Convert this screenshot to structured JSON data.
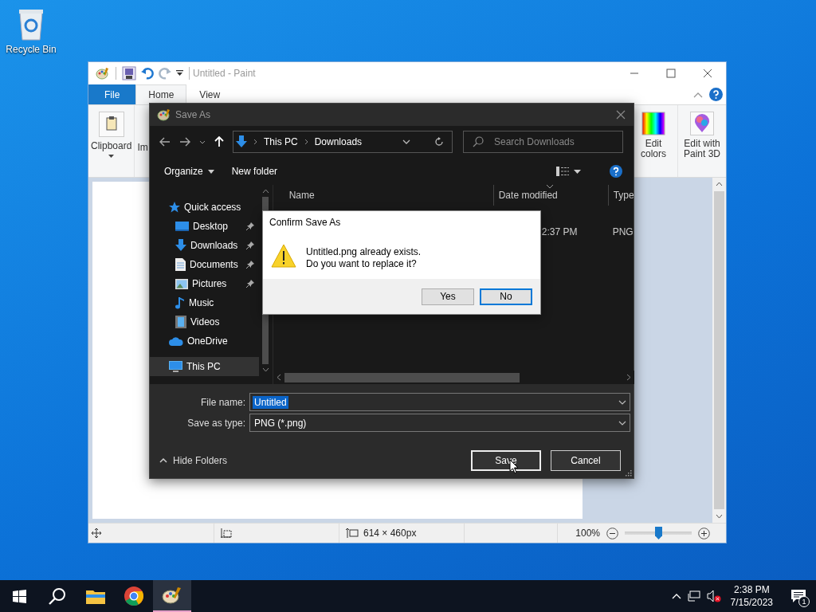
{
  "desktop_icons": [
    {
      "label": "Recycle Bin"
    }
  ],
  "paint": {
    "title": "Untitled - Paint",
    "tabs": [
      {
        "label": "File",
        "kind": "file",
        "selected": false
      },
      {
        "label": "Home",
        "kind": "tab",
        "selected": true
      },
      {
        "label": "View",
        "kind": "tab",
        "selected": false
      }
    ],
    "ribbon_left": [
      {
        "label": "Clipboard",
        "kind": "clipboard"
      },
      {
        "label": "Im",
        "kind": "cut"
      }
    ],
    "ribbon_right": [
      {
        "label": "Edit colors",
        "kind": "colors"
      },
      {
        "label": "Edit with Paint 3D",
        "kind": "paint3d"
      }
    ],
    "status": {
      "size": "614 × 460px",
      "zoom": "100%",
      "level": 0.5
    }
  },
  "save_as": {
    "title": "Save As",
    "breadcrumb": [
      "This PC",
      "Downloads"
    ],
    "search": {
      "placeholder": "Search Downloads"
    },
    "toolbar": [
      "Organize",
      "New folder"
    ],
    "nav": [
      {
        "label": "Quick access",
        "kind": "star",
        "selected": false,
        "children": [
          {
            "label": "Desktop",
            "kind": "desktop",
            "selected": false,
            "pinned": true
          },
          {
            "label": "Downloads",
            "kind": "download",
            "selected": false,
            "pinned": true
          },
          {
            "label": "Documents",
            "kind": "document",
            "selected": false,
            "pinned": true
          },
          {
            "label": "Pictures",
            "kind": "picture",
            "selected": false,
            "pinned": true
          },
          {
            "label": "Music",
            "kind": "music",
            "selected": false,
            "pinned": false
          },
          {
            "label": "Videos",
            "kind": "video",
            "selected": false,
            "pinned": false
          }
        ]
      },
      {
        "label": "OneDrive",
        "kind": "cloud",
        "selected": false
      },
      {
        "label": "This PC",
        "kind": "pc",
        "selected": true
      }
    ],
    "columns": [
      "Name",
      "Date modified",
      "Type"
    ],
    "rows": [
      {
        "date_modified": "2:37 PM",
        "type": "PNG"
      }
    ],
    "file_name": {
      "label": "File name:",
      "value": "Untitled",
      "selected": true
    },
    "save_as_type": {
      "label": "Save as type:",
      "value": "PNG (*.png)"
    },
    "hide_folders": "Hide Folders",
    "buttons": [
      {
        "label": "Save",
        "kind": "default"
      },
      {
        "label": "Cancel",
        "kind": "normal"
      }
    ]
  },
  "confirm": {
    "title": "Confirm Save As",
    "message": [
      "Untitled.png already exists.",
      "Do you want to replace it?"
    ],
    "buttons": [
      {
        "label": "Yes",
        "selected": false
      },
      {
        "label": "No",
        "selected": true
      }
    ]
  },
  "taskbar": {
    "items": [
      {
        "kind": "start",
        "selected": false
      },
      {
        "kind": "search",
        "selected": false
      },
      {
        "kind": "explorer",
        "selected": false
      },
      {
        "kind": "chrome",
        "selected": false
      },
      {
        "kind": "paint",
        "selected": true
      }
    ],
    "time": "2:38 PM",
    "date": "7/15/2023",
    "notifications": "1"
  }
}
